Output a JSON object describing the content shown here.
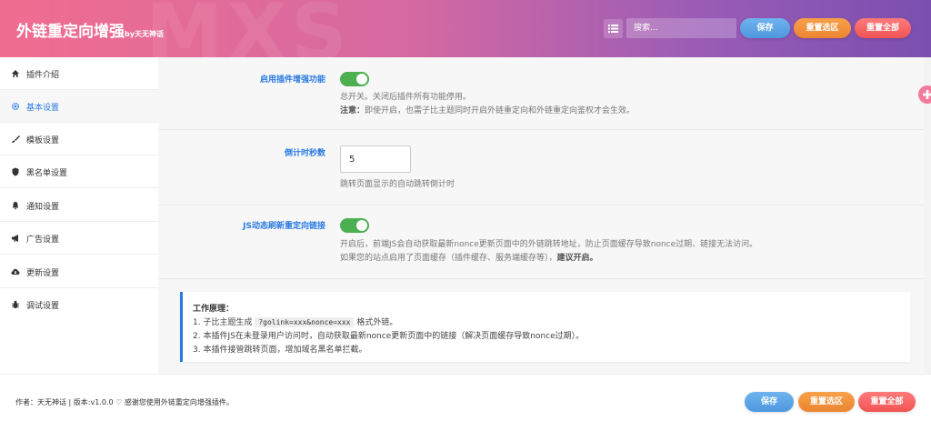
{
  "header": {
    "title": "外链重定向增强",
    "title_suffix": "by天无神话",
    "watermark": "MXS",
    "search_placeholder": "搜索...",
    "save_label": "保存",
    "reset_section_label": "重置选区",
    "reset_all_label": "重置全部"
  },
  "sidebar": {
    "items": [
      {
        "label": "插件介绍",
        "icon": "home-icon"
      },
      {
        "label": "基本设置",
        "icon": "gear-icon",
        "active": true
      },
      {
        "label": "模板设置",
        "icon": "brush-icon"
      },
      {
        "label": "黑名单设置",
        "icon": "shield-icon"
      },
      {
        "label": "通知设置",
        "icon": "bell-icon"
      },
      {
        "label": "广告设置",
        "icon": "megaphone-icon"
      },
      {
        "label": "更新设置",
        "icon": "cloud-download-icon"
      },
      {
        "label": "调试设置",
        "icon": "bug-icon"
      }
    ]
  },
  "main": {
    "enable": {
      "label": "启用插件增强功能",
      "on": true,
      "desc1": "总开关。关闭后插件所有功能停用。",
      "desc2_bold": "注意：",
      "desc2": "即使开启，也需子比主题同时开启外链重定向和外链重定向鉴权才会生效。"
    },
    "countdown": {
      "label": "倒计时秒数",
      "value": "5",
      "desc": "跳转页面显示的自动跳转倒计时"
    },
    "js_refresh": {
      "label": "JS动态刷新重定向链接",
      "on": true,
      "desc1": "开启后，前端JS会自动获取最新nonce更新页面中的外链跳转地址，防止页面缓存导致nonce过期、链接无法访问。",
      "desc2": "如果您的站点启用了页面缓存（插件缓存、服务端缓存等），",
      "desc2_bold": "建议开启。"
    },
    "info": {
      "title": "工作原理：",
      "line1_pre": "1. 子比主题生成",
      "line1_code": "?golink=xxx&nonce=xxx",
      "line1_post": "格式外链。",
      "line2": "2. 本插件JS在未登录用户访问时，自动获取最新nonce更新页面中的链接（解决页面缓存导致nonce过期）。",
      "line3": "3. 本插件接管跳转页面，增加域名黑名单拦截。"
    }
  },
  "footer": {
    "credit_pre": "作者：天无神话 | 版本:v1.0.0",
    "heart": "♡",
    "credit_post": "感谢您使用外链重定向增强插件。",
    "save_label": "保存",
    "reset_section_label": "重置选区",
    "reset_all_label": "重置全部"
  },
  "colors": {
    "accent": "#2a7ae2",
    "toggle_on": "#4caf50",
    "save": "#4f97e0",
    "reset": "#ec8531",
    "reset_all": "#f05454"
  }
}
